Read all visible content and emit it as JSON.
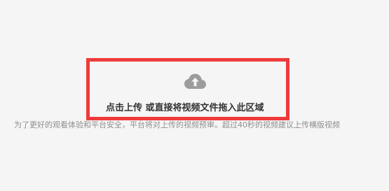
{
  "upload": {
    "prompt": "点击上传 或直接将视频文件拖入此区域",
    "icon": "cloud-upload-icon",
    "help": "为了更好的观看体验和平台安全，平台将对上传的视频预审。超过40秒的视频建议上传横版视频"
  },
  "colors": {
    "background": "#f5f5f5",
    "highlight_border": "#ef3a3a",
    "icon": "#9c9c9c",
    "primary_text": "#333333",
    "secondary_text": "#8f8f8f"
  }
}
